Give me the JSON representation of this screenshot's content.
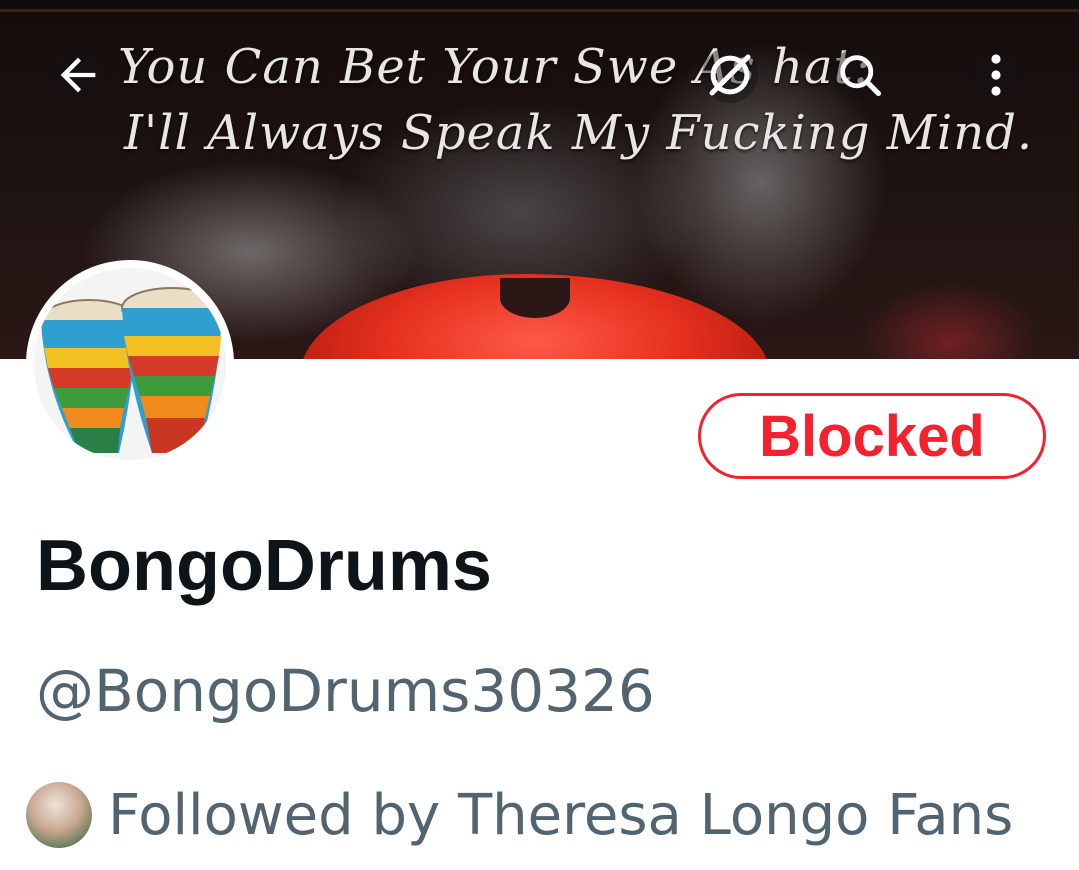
{
  "banner": {
    "quote_line1": "You Can Bet Your Swe        As    hat:",
    "quote_line2": "I'll Always Speak My Fucking Mind."
  },
  "header_icons": {
    "back": "arrow-left-icon",
    "block": "blocked-icon",
    "search": "search-icon",
    "more": "more-vertical-icon"
  },
  "profile": {
    "avatar_icon": "bongo-drums-avatar",
    "display_name": "BongoDrums",
    "handle": "@BongoDrums30326",
    "followed_by_text": "Followed by Theresa Longo Fans"
  },
  "actions": {
    "blocked_label": "Blocked"
  },
  "colors": {
    "blocked_red": "#f4212e",
    "name": "#0f1419",
    "secondary": "#536471"
  }
}
